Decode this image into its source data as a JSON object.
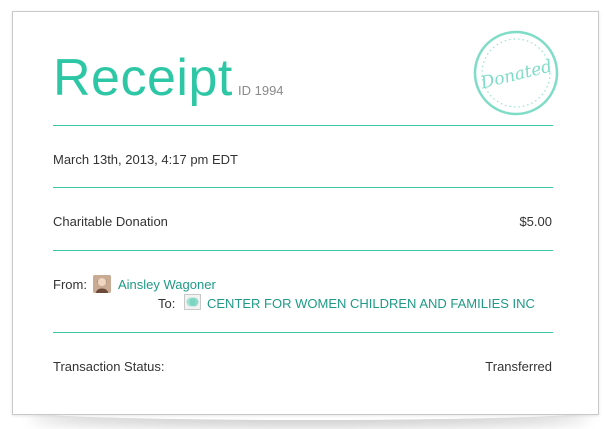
{
  "receipt": {
    "title": "Receipt",
    "id_label": "ID 1994",
    "stamp_text": "Donated",
    "date": "March 13th, 2013, 4:17 pm EDT",
    "item": {
      "label": "Charitable Donation",
      "amount": "$5.00"
    },
    "from": {
      "label": "From:",
      "name": "Ainsley Wagoner"
    },
    "to": {
      "label": "To:",
      "name": "CENTER FOR WOMEN CHILDREN AND FAMILIES INC"
    },
    "status": {
      "label": "Transaction Status:",
      "value": "Transferred"
    }
  },
  "colors": {
    "accent": "#2ec7a5",
    "link": "#1e9a86",
    "text": "#333333",
    "muted": "#8a8a8a"
  }
}
